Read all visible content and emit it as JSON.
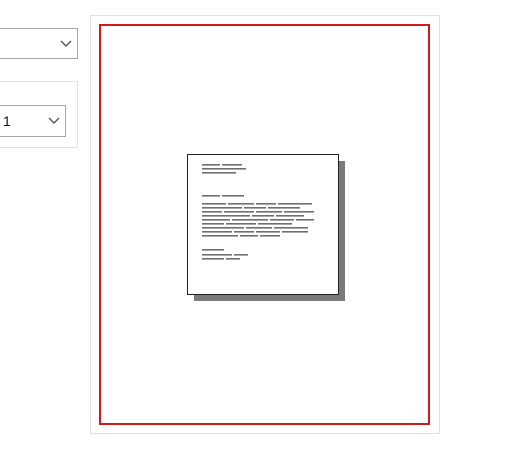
{
  "print_settings": {
    "top_select": {
      "value": ""
    },
    "copies_select": {
      "value": "1"
    }
  },
  "preview": {
    "printable_area_border_color": "#d11a1a",
    "thumbnail": {
      "icon": "document-thumbnail-icon"
    }
  }
}
